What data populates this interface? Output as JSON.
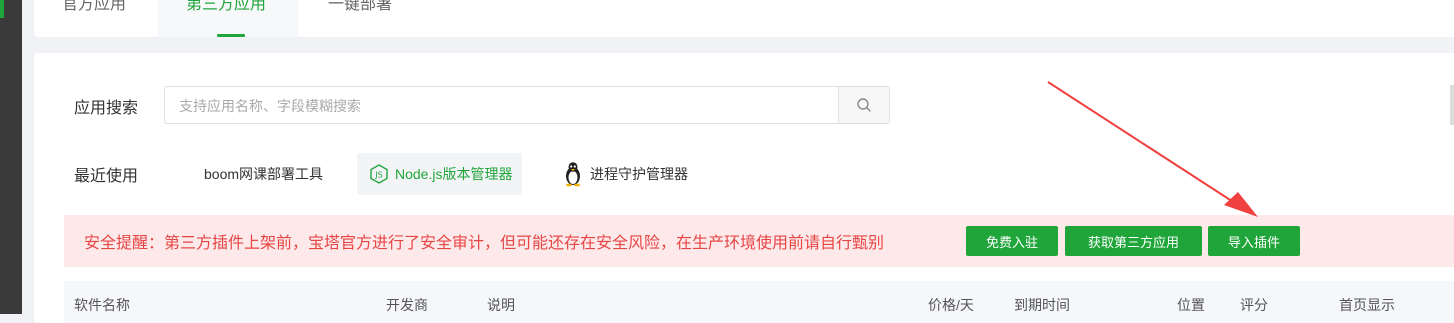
{
  "tabs": [
    {
      "label": "官方应用"
    },
    {
      "label": "第三方应用"
    },
    {
      "label": "一键部署"
    }
  ],
  "active_tab_index": 1,
  "search": {
    "label": "应用搜索",
    "placeholder": "支持应用名称、字段模糊搜索",
    "value": ""
  },
  "recent": {
    "label": "最近使用",
    "items": [
      {
        "label": "boom网课部署工具",
        "icon": "none"
      },
      {
        "label": "Node.js版本管理器",
        "icon": "nodejs-icon"
      },
      {
        "label": "进程守护管理器",
        "icon": "linux-penguin-icon"
      }
    ]
  },
  "alert": {
    "text": "安全提醒：第三方插件上架前，宝塔官方进行了安全审计，但可能还存在安全风险，在生产环境使用前请自行甄别",
    "buttons": [
      "免费入驻",
      "获取第三方应用",
      "导入插件"
    ]
  },
  "table": {
    "columns": [
      "软件名称",
      "开发商",
      "说明",
      "价格/天",
      "到期时间",
      "位置",
      "评分",
      "首页显示"
    ]
  },
  "colors": {
    "accent": "#20a53a",
    "alert_bg": "#fde9e9",
    "alert_text": "#e64545",
    "arrow": "#f04040"
  }
}
